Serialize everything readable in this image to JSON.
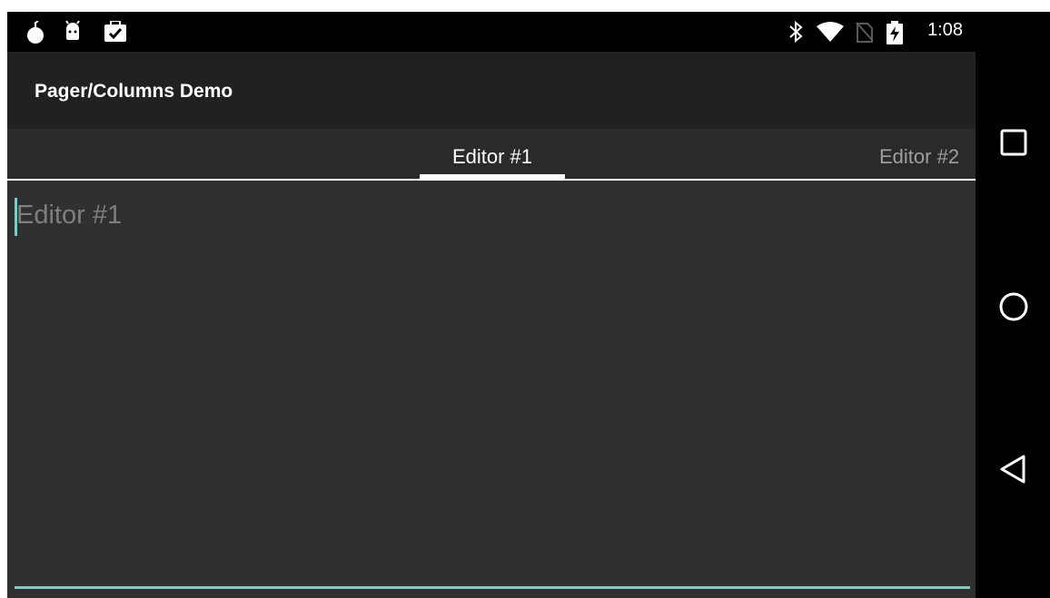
{
  "status_bar": {
    "left_icons": [
      "bomb-icon",
      "android-icon",
      "clipboard-check-icon"
    ],
    "right_icons": [
      "bluetooth-icon",
      "wifi-icon",
      "no-sim-icon",
      "battery-charging-icon"
    ],
    "time": "1:08"
  },
  "action_bar": {
    "title": "Pager/Columns Demo",
    "background": "#212121"
  },
  "tabs": [
    {
      "label": "Editor #1",
      "selected": true
    },
    {
      "label": "Editor #2",
      "selected": false
    }
  ],
  "editor": {
    "value": "",
    "placeholder": "Editor #1",
    "accent": "#80cbc4"
  },
  "nav_bar": {
    "buttons": [
      "recents-icon",
      "home-icon",
      "back-icon"
    ]
  }
}
